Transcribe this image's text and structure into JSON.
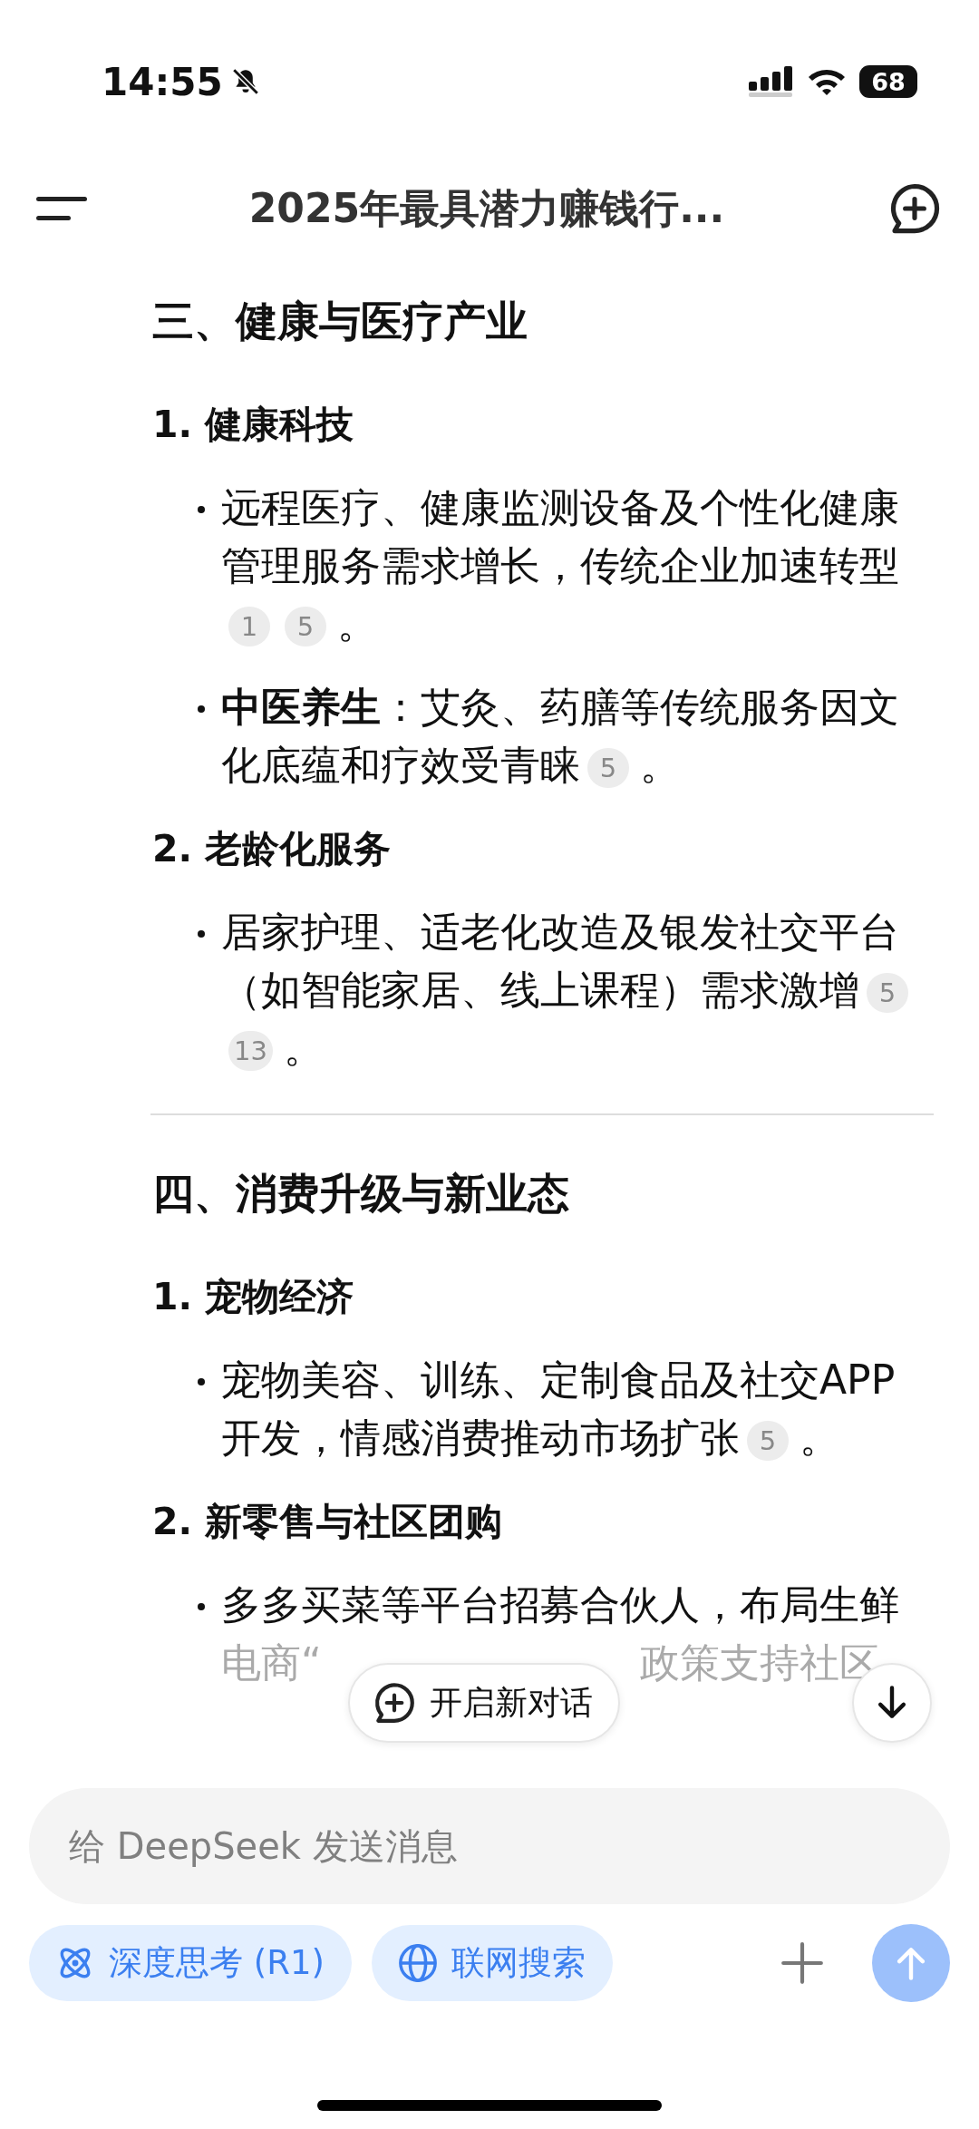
{
  "status_bar": {
    "time": "14:55",
    "battery": "68"
  },
  "header": {
    "title": "2025年最具潜力赚钱行..."
  },
  "sections": [
    {
      "title": "三、健康与医疗产业",
      "items": [
        {
          "number": "1.",
          "title": "健康科技",
          "bullets": [
            {
              "text": "远程医疗、健康监测设备及个性化健康管理服务需求增长，传统企业加速转型",
              "citations": [
                "1",
                "5"
              ],
              "end": "。"
            },
            {
              "text": "**中医养生**：艾灸、药膳等传统服务因文化底蕴和疗效受青睐",
              "citations": [
                "5"
              ],
              "end": "。"
            }
          ]
        },
        {
          "number": "2.",
          "title": "老龄化服务",
          "bullets": [
            {
              "text": "居家护理、适老化改造及银发社交平台（如智能家居、线上课程）需求激增",
              "citations": [
                "5",
                "13"
              ],
              "end": "。"
            }
          ]
        }
      ]
    },
    {
      "title": "四、消费升级与新业态",
      "items": [
        {
          "number": "1.",
          "title": "宠物经济",
          "bullets": [
            {
              "text": "宠物美容、训练、定制食品及社交APP开发，情感消费推动市场扩张",
              "citations": [
                "5"
              ],
              "end": "。"
            }
          ]
        },
        {
          "number": "2.",
          "title": "新零售与社区团购",
          "bullets": [
            {
              "text": "多多买菜等平台招募合伙人，布局生鲜",
              "fragments": [
                "电商“",
                "政策支持社区"
              ]
            }
          ]
        }
      ]
    }
  ],
  "new_chat_button": {
    "label": "开启新对话"
  },
  "composer": {
    "placeholder": "给 DeepSeek 发送消息",
    "chips": [
      {
        "label": "深度思考 (R1)",
        "kind": "atom",
        "selected": true
      },
      {
        "label": "联网搜索",
        "kind": "globe",
        "selected": true
      }
    ],
    "send_button": {
      "disabled": true
    }
  }
}
